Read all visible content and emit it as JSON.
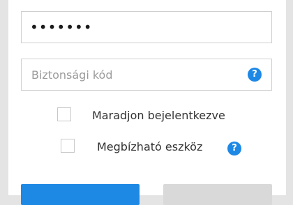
{
  "password_field": {
    "value": "•••••••"
  },
  "security_code_field": {
    "placeholder": "Biztonsági kód",
    "help_icon": "question-mark"
  },
  "remember_me": {
    "label": "Maradjon bejelentkezve",
    "checked": false
  },
  "trusted_device": {
    "label": "Megbízható eszköz",
    "checked": false,
    "help_icon": "question-mark"
  },
  "help_icon_glyph": "?",
  "colors": {
    "accent": "#1e88e5",
    "secondary_button": "#d9d9d9",
    "border": "#cfcfcf",
    "placeholder": "#9a9a9a"
  }
}
